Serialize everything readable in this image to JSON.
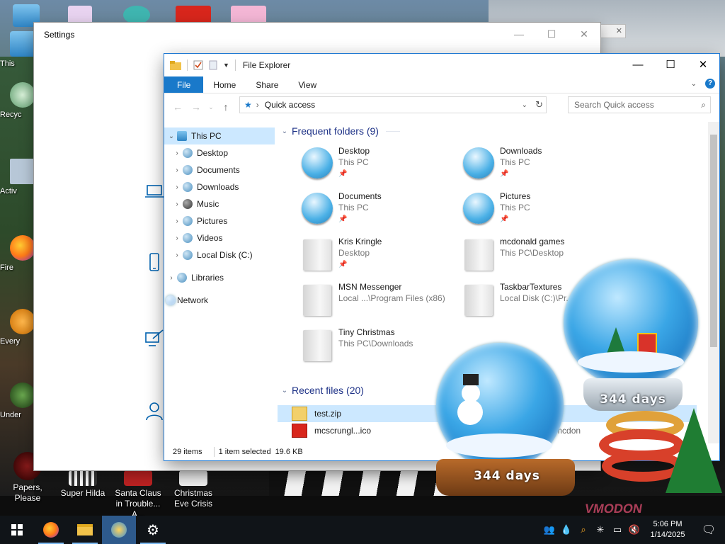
{
  "desktop": {
    "left_icons": [
      {
        "label": "This",
        "icon": "this-pc-icon"
      },
      {
        "label": "Recyc",
        "icon": "recycle-bin-icon"
      },
      {
        "label": "Activ",
        "icon": "activation-icon"
      },
      {
        "label": "Fire",
        "icon": "firefox-icon"
      },
      {
        "label": "Every",
        "icon": "everything-icon"
      },
      {
        "label": "Under",
        "icon": "undertale-icon"
      }
    ],
    "bottom_icons": [
      {
        "label": "Papers, Please",
        "icon": "papers-please-icon"
      },
      {
        "label": "Super Hilda",
        "icon": "super-hilda-icon"
      },
      {
        "label": "Santa Claus in Trouble... A...",
        "icon": "santa-claus-game-icon"
      },
      {
        "label": "Christmas Eve Crisis",
        "icon": "christmas-eve-icon"
      }
    ]
  },
  "settings": {
    "title": "Settings",
    "minimize": "—",
    "maximize": "☐",
    "close": "✕"
  },
  "explorer": {
    "title": "File Explorer",
    "minimize": "—",
    "maximize": "☐",
    "close": "✕",
    "ribbon_tabs": [
      "File",
      "Home",
      "Share",
      "View"
    ],
    "address": "Quick access",
    "search_placeholder": "Search Quick access",
    "nav_pane": [
      {
        "label": "This PC",
        "level": 0,
        "expanded": true,
        "icon": "this-pc-icon"
      },
      {
        "label": "Desktop",
        "level": 1,
        "icon": "desktop-folder-icon"
      },
      {
        "label": "Documents",
        "level": 1,
        "icon": "documents-folder-icon"
      },
      {
        "label": "Downloads",
        "level": 1,
        "icon": "downloads-folder-icon"
      },
      {
        "label": "Music",
        "level": 1,
        "icon": "music-folder-icon"
      },
      {
        "label": "Pictures",
        "level": 1,
        "icon": "pictures-folder-icon"
      },
      {
        "label": "Videos",
        "level": 1,
        "icon": "videos-folder-icon"
      },
      {
        "label": "Local Disk (C:)",
        "level": 1,
        "icon": "local-disk-icon"
      },
      {
        "label": "Libraries",
        "level": 0,
        "icon": "libraries-icon"
      },
      {
        "label": "Network",
        "level": 0,
        "icon": "network-icon"
      }
    ],
    "frequent_header": "Frequent folders (9)",
    "frequent": [
      {
        "name": "Desktop",
        "location": "This PC"
      },
      {
        "name": "Downloads",
        "location": "This PC"
      },
      {
        "name": "Documents",
        "location": "This PC"
      },
      {
        "name": "Pictures",
        "location": "This PC"
      },
      {
        "name": "Kris Kringle",
        "location": "Desktop"
      },
      {
        "name": "mcdonald games",
        "location": "This PC\\Desktop"
      },
      {
        "name": "MSN Messenger",
        "location": "Local ...\\Program Files (x86)"
      },
      {
        "name": "TaskbarTextures",
        "location": "Local Disk (C:)\\Pr..."
      },
      {
        "name": "Tiny Christmas",
        "location": "This PC\\Downloads"
      }
    ],
    "recent_header": "Recent files (20)",
    "recent": [
      {
        "name": "test.zip",
        "path": "ads"
      },
      {
        "name": "mcscrungl...ico",
        "path": "o\\mcdon"
      }
    ],
    "status": {
      "items": "29 items",
      "selected": "1 item selected",
      "size": "19.6 KB"
    }
  },
  "snow_globes": [
    {
      "label": "344 days"
    },
    {
      "label": "344 days"
    }
  ],
  "watermark": "VMODON",
  "taskbar": {
    "apps": [
      "start-button",
      "firefox",
      "file-explorer",
      "pinned-app",
      "settings"
    ],
    "time": "5:06 PM",
    "date": "1/14/2025"
  }
}
